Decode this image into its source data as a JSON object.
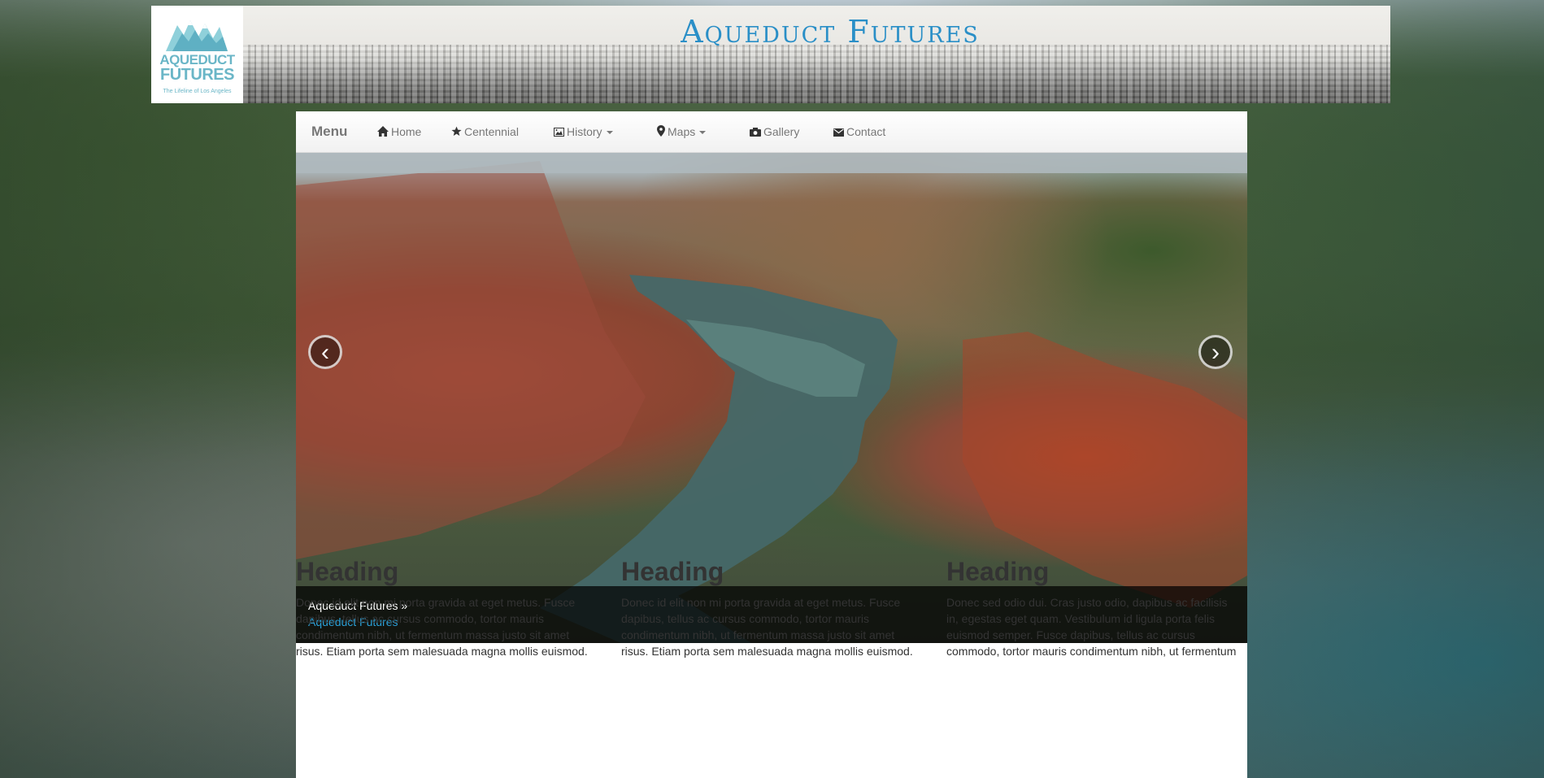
{
  "header": {
    "title": "Aqueduct Futures",
    "logo_text_line1": "AQUEDUCT",
    "logo_text_line2": "FUTURES",
    "logo_tagline": "The Lifeline of Los Angeles"
  },
  "navbar": {
    "brand": "Menu",
    "items": [
      {
        "label": "Home",
        "icon": "home-icon"
      },
      {
        "label": "Centennial",
        "icon": "star-icon"
      },
      {
        "label": "History",
        "icon": "picture-icon",
        "dropdown": true
      },
      {
        "label": "Maps",
        "icon": "map-marker-icon",
        "dropdown": true
      },
      {
        "label": "Gallery",
        "icon": "camera-icon"
      },
      {
        "label": "Contact",
        "icon": "envelope-icon"
      }
    ]
  },
  "carousel": {
    "prev": "‹",
    "next": "›",
    "caption_title": "Aqueduct Futures »",
    "caption_link": "Aqueduct Futures"
  },
  "columns": [
    {
      "heading": "Heading",
      "text": "Donec id elit non mi porta gravida at eget metus. Fusce dapibus, tellus ac cursus commodo, tortor mauris condimentum nibh, ut fermentum massa justo sit amet risus. Etiam porta sem malesuada magna mollis euismod."
    },
    {
      "heading": "Heading",
      "text": "Donec id elit non mi porta gravida at eget metus. Fusce dapibus, tellus ac cursus commodo, tortor mauris condimentum nibh, ut fermentum massa justo sit amet risus. Etiam porta sem malesuada magna mollis euismod."
    },
    {
      "heading": "Heading",
      "text": "Donec sed odio dui. Cras justo odio, dapibus ac facilisis in, egestas eget quam. Vestibulum id ligula porta felis euismod semper. Fusce dapibus, tellus ac cursus commodo, tortor mauris condimentum nibh, ut fermentum"
    }
  ],
  "colors": {
    "title_blue": "#2a8fc7",
    "link_blue": "#2a9fd6",
    "logo_teal": "#6ab6c7",
    "nav_text": "#777777"
  }
}
